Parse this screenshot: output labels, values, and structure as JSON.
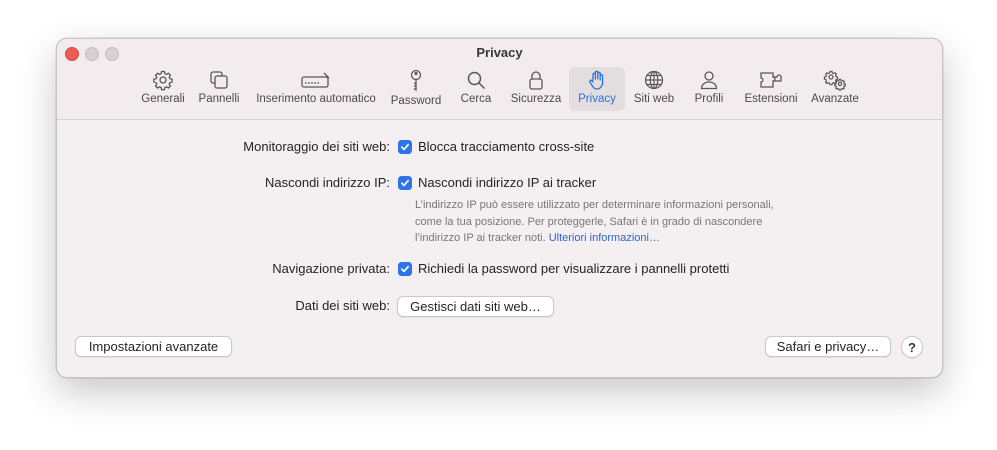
{
  "window": {
    "title": "Privacy"
  },
  "toolbar": {
    "tabs": [
      {
        "label": "Generali",
        "icon": "gear-icon"
      },
      {
        "label": "Pannelli",
        "icon": "tabs-icon"
      },
      {
        "label": "Inserimento automatico",
        "icon": "autofill-icon"
      },
      {
        "label": "Password",
        "icon": "key-icon"
      },
      {
        "label": "Cerca",
        "icon": "magnifier-icon"
      },
      {
        "label": "Sicurezza",
        "icon": "lock-icon"
      },
      {
        "label": "Privacy",
        "icon": "hand-icon",
        "selected": true
      },
      {
        "label": "Siti web",
        "icon": "globe-icon"
      },
      {
        "label": "Profili",
        "icon": "person-icon"
      },
      {
        "label": "Estensioni",
        "icon": "puzzle-icon"
      },
      {
        "label": "Avanzate",
        "icon": "gears-icon"
      }
    ]
  },
  "settings": {
    "tracking": {
      "label": "Monitoraggio dei siti web:",
      "checkbox": "Blocca tracciamento cross-site",
      "checked": true
    },
    "hide_ip": {
      "label": "Nascondi indirizzo IP:",
      "checkbox": "Nascondi indirizzo IP ai tracker",
      "checked": true,
      "note": "L’indirizzo IP può essere utilizzato per determinare informazioni personali, come la tua posizione. Per proteggerle, Safari è in grado di nascondere l’indirizzo IP ai tracker noti.",
      "link": "Ulteriori informazioni…"
    },
    "private_nav": {
      "label": "Navigazione privata:",
      "checkbox": "Richiedi la password per visualizzare i pannelli protetti",
      "checked": true
    },
    "site_data": {
      "label": "Dati dei siti web:",
      "button": "Gestisci dati siti web…"
    }
  },
  "footer": {
    "advanced_button": "Impostazioni avanzate",
    "safari_privacy_button": "Safari e privacy…",
    "help_button": "?"
  },
  "colors": {
    "accent": "#2d75e6",
    "selected_tab_bg": "#e4dde0",
    "window_bg": "#f4eff1"
  }
}
